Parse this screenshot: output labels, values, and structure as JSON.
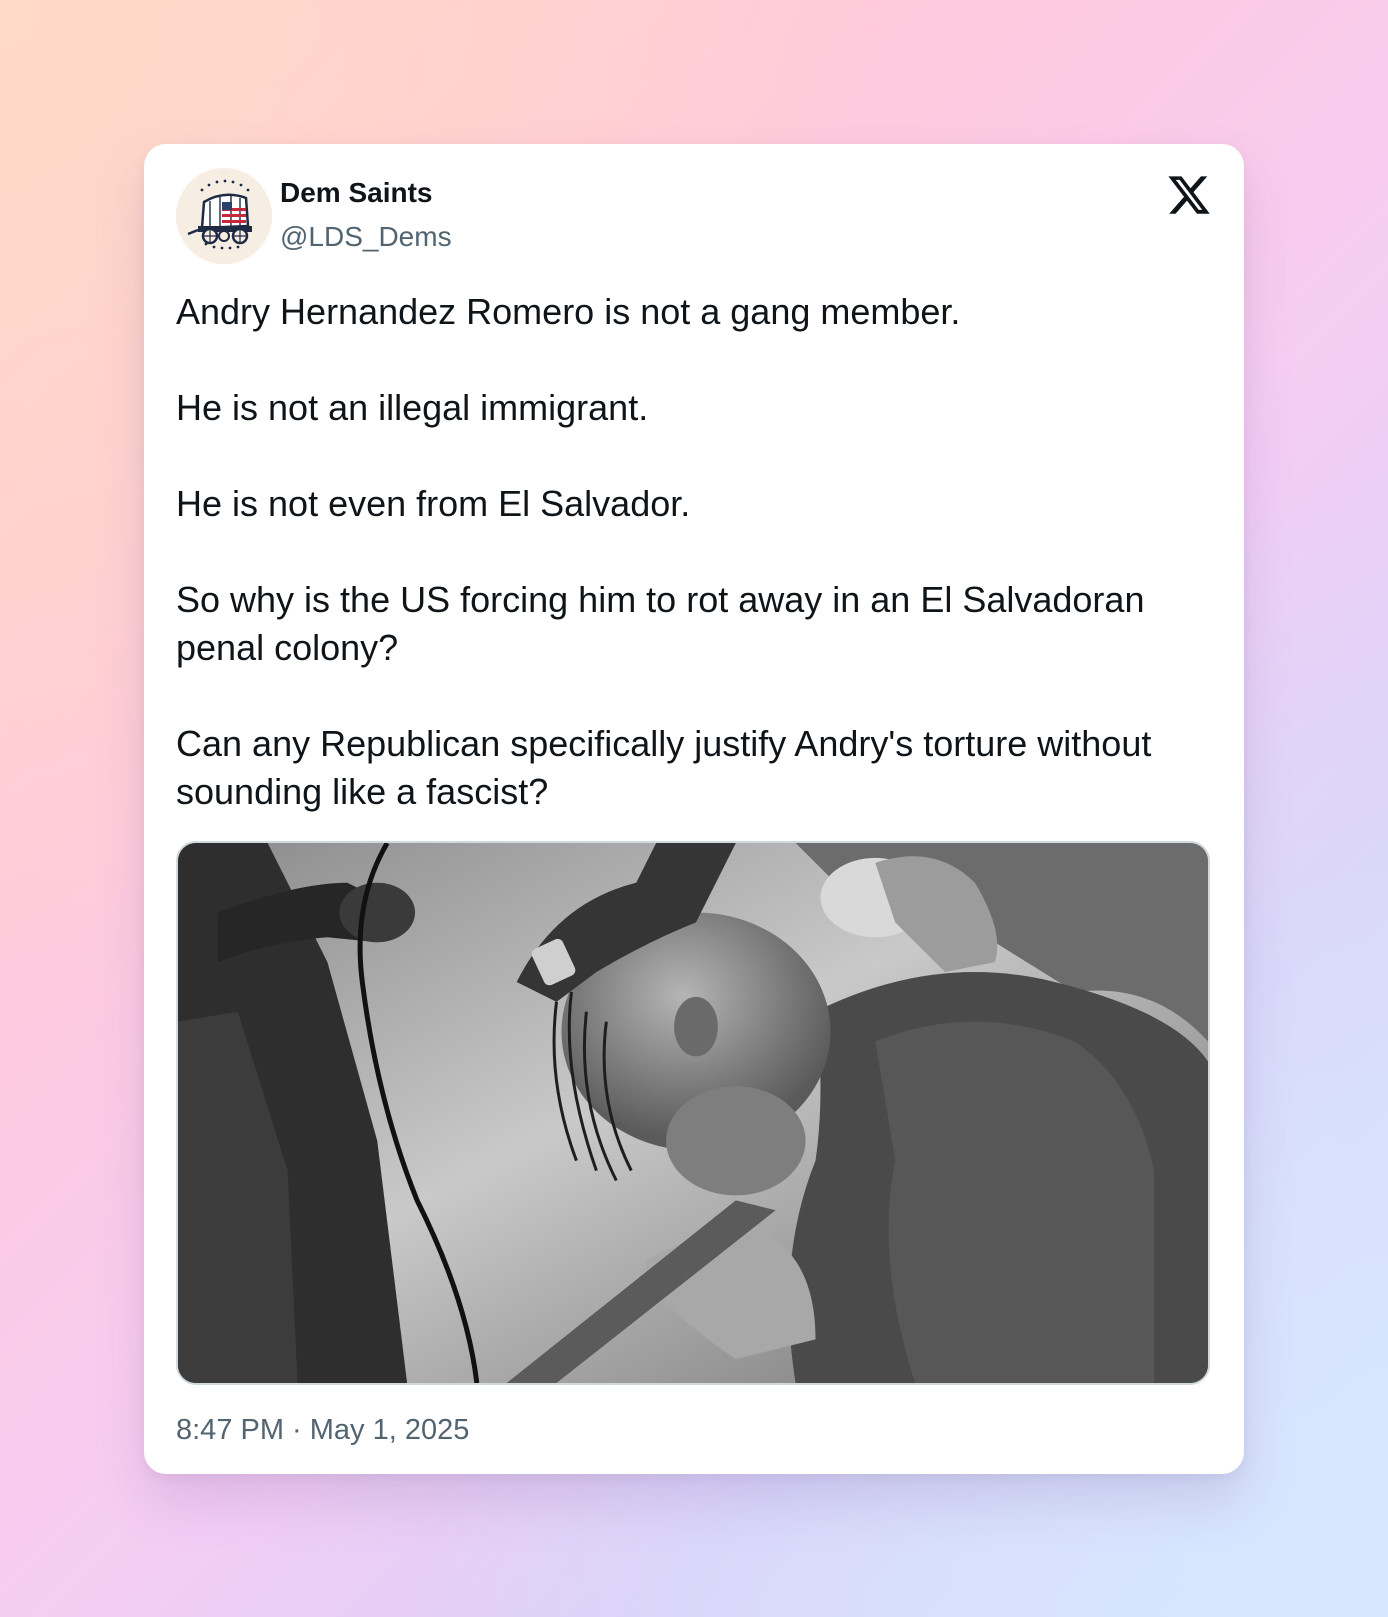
{
  "author": {
    "name": "Dem Saints",
    "handle": "@LDS_Dems",
    "avatar_icon": "covered-wagon-flag-icon"
  },
  "platform_icon": "x-logo-icon",
  "tweet": {
    "paragraphs": [
      "Andry Hernandez Romero is not a gang member.",
      "He is not an illegal immigrant.",
      "He is not even from El Salvador.",
      "So why is the US forcing him to rot away in an El Salvadoran penal colony?",
      "Can any Republican specifically justify Andry's torture without sounding like a fascist?"
    ]
  },
  "media": {
    "kind": "black-and-white photo"
  },
  "timestamp": "8:47 PM · May 1, 2025",
  "colors": {
    "text_primary": "#0f1419",
    "text_secondary": "#536471",
    "card_background": "#ffffff",
    "media_border": "#cfd9de"
  }
}
